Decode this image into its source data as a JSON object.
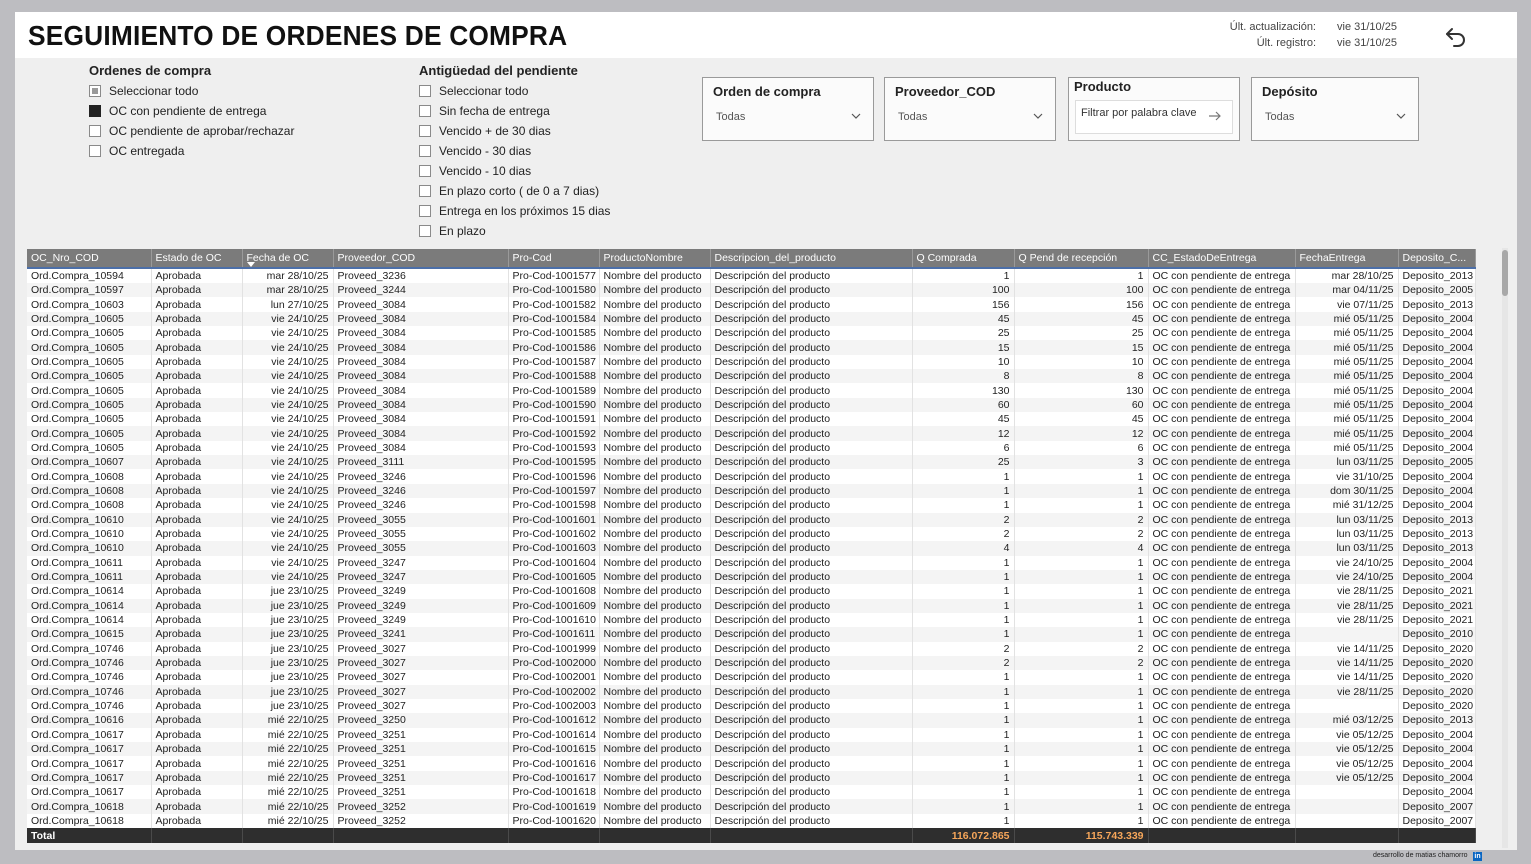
{
  "title": "SEGUIMIENTO DE ORDENES DE COMPRA",
  "update": {
    "last_update_label": "Últ. actualización:",
    "last_update_value": "vie 31/10/25",
    "last_record_label": "Últ. registro:",
    "last_record_value": "vie 31/10/25"
  },
  "back_icon": "undo-arrow-icon",
  "slicer_oc": {
    "title": "Ordenes de compra",
    "items": [
      {
        "label": "Seleccionar todo",
        "state": "partial"
      },
      {
        "label": "OC con pendiente de entrega",
        "state": "checked"
      },
      {
        "label": "OC pendiente de aprobar/rechazar",
        "state": "unchecked"
      },
      {
        "label": "OC entregada",
        "state": "unchecked"
      }
    ]
  },
  "slicer_age": {
    "title": "Antigüedad del pendiente",
    "items": [
      {
        "label": "Seleccionar todo",
        "state": "unchecked"
      },
      {
        "label": "Sin fecha de entrega",
        "state": "unchecked"
      },
      {
        "label": "Vencido + de 30 dias",
        "state": "unchecked"
      },
      {
        "label": "Vencido - 30 dias",
        "state": "unchecked"
      },
      {
        "label": "Vencido - 10 dias",
        "state": "unchecked"
      },
      {
        "label": "En plazo corto ( de 0 a 7 dias)",
        "state": "unchecked"
      },
      {
        "label": "Entrega en los próximos 15 dias",
        "state": "unchecked"
      },
      {
        "label": "En plazo",
        "state": "unchecked"
      }
    ]
  },
  "filters": {
    "orden": {
      "title": "Orden de compra",
      "value": "Todas"
    },
    "proveedor": {
      "title": "Proveedor_COD",
      "value": "Todas"
    },
    "producto": {
      "title": "Producto",
      "placeholder": "Filtrar por palabra clave"
    },
    "deposito": {
      "title": "Depósito",
      "value": "Todas"
    }
  },
  "table": {
    "columns": [
      "OC_Nro_COD",
      "Estado de OC",
      "Fecha de OC",
      "Proveedor_COD",
      "Pro-Cod",
      "ProductoNombre",
      "Descripcion_del_producto",
      "Q Comprada",
      "Q Pend de recepción",
      "CC_EstadoDeEntrega",
      "FechaEntrega",
      "Deposito_C..."
    ],
    "rows": [
      [
        "Ord.Compra_10594",
        "Aprobada",
        "mar 28/10/25",
        "Proveed_3236",
        "Pro-Cod-1001577",
        "Nombre del producto",
        "Descripción del producto",
        "1",
        "1",
        "OC con pendiente de entrega",
        "mar 28/10/25",
        "Deposito_2013"
      ],
      [
        "Ord.Compra_10597",
        "Aprobada",
        "mar 28/10/25",
        "Proveed_3244",
        "Pro-Cod-1001580",
        "Nombre del producto",
        "Descripción del producto",
        "100",
        "100",
        "OC con pendiente de entrega",
        "mar 04/11/25",
        "Deposito_2005"
      ],
      [
        "Ord.Compra_10603",
        "Aprobada",
        "lun 27/10/25",
        "Proveed_3084",
        "Pro-Cod-1001582",
        "Nombre del producto",
        "Descripción del producto",
        "156",
        "156",
        "OC con pendiente de entrega",
        "vie 07/11/25",
        "Deposito_2013"
      ],
      [
        "Ord.Compra_10605",
        "Aprobada",
        "vie 24/10/25",
        "Proveed_3084",
        "Pro-Cod-1001584",
        "Nombre del producto",
        "Descripción del producto",
        "45",
        "45",
        "OC con pendiente de entrega",
        "mié 05/11/25",
        "Deposito_2004"
      ],
      [
        "Ord.Compra_10605",
        "Aprobada",
        "vie 24/10/25",
        "Proveed_3084",
        "Pro-Cod-1001585",
        "Nombre del producto",
        "Descripción del producto",
        "25",
        "25",
        "OC con pendiente de entrega",
        "mié 05/11/25",
        "Deposito_2004"
      ],
      [
        "Ord.Compra_10605",
        "Aprobada",
        "vie 24/10/25",
        "Proveed_3084",
        "Pro-Cod-1001586",
        "Nombre del producto",
        "Descripción del producto",
        "15",
        "15",
        "OC con pendiente de entrega",
        "mié 05/11/25",
        "Deposito_2004"
      ],
      [
        "Ord.Compra_10605",
        "Aprobada",
        "vie 24/10/25",
        "Proveed_3084",
        "Pro-Cod-1001587",
        "Nombre del producto",
        "Descripción del producto",
        "10",
        "10",
        "OC con pendiente de entrega",
        "mié 05/11/25",
        "Deposito_2004"
      ],
      [
        "Ord.Compra_10605",
        "Aprobada",
        "vie 24/10/25",
        "Proveed_3084",
        "Pro-Cod-1001588",
        "Nombre del producto",
        "Descripción del producto",
        "8",
        "8",
        "OC con pendiente de entrega",
        "mié 05/11/25",
        "Deposito_2004"
      ],
      [
        "Ord.Compra_10605",
        "Aprobada",
        "vie 24/10/25",
        "Proveed_3084",
        "Pro-Cod-1001589",
        "Nombre del producto",
        "Descripción del producto",
        "130",
        "130",
        "OC con pendiente de entrega",
        "mié 05/11/25",
        "Deposito_2004"
      ],
      [
        "Ord.Compra_10605",
        "Aprobada",
        "vie 24/10/25",
        "Proveed_3084",
        "Pro-Cod-1001590",
        "Nombre del producto",
        "Descripción del producto",
        "60",
        "60",
        "OC con pendiente de entrega",
        "mié 05/11/25",
        "Deposito_2004"
      ],
      [
        "Ord.Compra_10605",
        "Aprobada",
        "vie 24/10/25",
        "Proveed_3084",
        "Pro-Cod-1001591",
        "Nombre del producto",
        "Descripción del producto",
        "45",
        "45",
        "OC con pendiente de entrega",
        "mié 05/11/25",
        "Deposito_2004"
      ],
      [
        "Ord.Compra_10605",
        "Aprobada",
        "vie 24/10/25",
        "Proveed_3084",
        "Pro-Cod-1001592",
        "Nombre del producto",
        "Descripción del producto",
        "12",
        "12",
        "OC con pendiente de entrega",
        "mié 05/11/25",
        "Deposito_2004"
      ],
      [
        "Ord.Compra_10605",
        "Aprobada",
        "vie 24/10/25",
        "Proveed_3084",
        "Pro-Cod-1001593",
        "Nombre del producto",
        "Descripción del producto",
        "6",
        "6",
        "OC con pendiente de entrega",
        "mié 05/11/25",
        "Deposito_2004"
      ],
      [
        "Ord.Compra_10607",
        "Aprobada",
        "vie 24/10/25",
        "Proveed_3111",
        "Pro-Cod-1001595",
        "Nombre del producto",
        "Descripción del producto",
        "25",
        "3",
        "OC con pendiente de entrega",
        "lun 03/11/25",
        "Deposito_2005"
      ],
      [
        "Ord.Compra_10608",
        "Aprobada",
        "vie 24/10/25",
        "Proveed_3246",
        "Pro-Cod-1001596",
        "Nombre del producto",
        "Descripción del producto",
        "1",
        "1",
        "OC con pendiente de entrega",
        "vie 31/10/25",
        "Deposito_2004"
      ],
      [
        "Ord.Compra_10608",
        "Aprobada",
        "vie 24/10/25",
        "Proveed_3246",
        "Pro-Cod-1001597",
        "Nombre del producto",
        "Descripción del producto",
        "1",
        "1",
        "OC con pendiente de entrega",
        "dom 30/11/25",
        "Deposito_2004"
      ],
      [
        "Ord.Compra_10608",
        "Aprobada",
        "vie 24/10/25",
        "Proveed_3246",
        "Pro-Cod-1001598",
        "Nombre del producto",
        "Descripción del producto",
        "1",
        "1",
        "OC con pendiente de entrega",
        "mié 31/12/25",
        "Deposito_2004"
      ],
      [
        "Ord.Compra_10610",
        "Aprobada",
        "vie 24/10/25",
        "Proveed_3055",
        "Pro-Cod-1001601",
        "Nombre del producto",
        "Descripción del producto",
        "2",
        "2",
        "OC con pendiente de entrega",
        "lun 03/11/25",
        "Deposito_2013"
      ],
      [
        "Ord.Compra_10610",
        "Aprobada",
        "vie 24/10/25",
        "Proveed_3055",
        "Pro-Cod-1001602",
        "Nombre del producto",
        "Descripción del producto",
        "2",
        "2",
        "OC con pendiente de entrega",
        "lun 03/11/25",
        "Deposito_2013"
      ],
      [
        "Ord.Compra_10610",
        "Aprobada",
        "vie 24/10/25",
        "Proveed_3055",
        "Pro-Cod-1001603",
        "Nombre del producto",
        "Descripción del producto",
        "4",
        "4",
        "OC con pendiente de entrega",
        "lun 03/11/25",
        "Deposito_2013"
      ],
      [
        "Ord.Compra_10611",
        "Aprobada",
        "vie 24/10/25",
        "Proveed_3247",
        "Pro-Cod-1001604",
        "Nombre del producto",
        "Descripción del producto",
        "1",
        "1",
        "OC con pendiente de entrega",
        "vie 24/10/25",
        "Deposito_2004"
      ],
      [
        "Ord.Compra_10611",
        "Aprobada",
        "vie 24/10/25",
        "Proveed_3247",
        "Pro-Cod-1001605",
        "Nombre del producto",
        "Descripción del producto",
        "1",
        "1",
        "OC con pendiente de entrega",
        "vie 24/10/25",
        "Deposito_2004"
      ],
      [
        "Ord.Compra_10614",
        "Aprobada",
        "jue 23/10/25",
        "Proveed_3249",
        "Pro-Cod-1001608",
        "Nombre del producto",
        "Descripción del producto",
        "1",
        "1",
        "OC con pendiente de entrega",
        "vie 28/11/25",
        "Deposito_2021"
      ],
      [
        "Ord.Compra_10614",
        "Aprobada",
        "jue 23/10/25",
        "Proveed_3249",
        "Pro-Cod-1001609",
        "Nombre del producto",
        "Descripción del producto",
        "1",
        "1",
        "OC con pendiente de entrega",
        "vie 28/11/25",
        "Deposito_2021"
      ],
      [
        "Ord.Compra_10614",
        "Aprobada",
        "jue 23/10/25",
        "Proveed_3249",
        "Pro-Cod-1001610",
        "Nombre del producto",
        "Descripción del producto",
        "1",
        "1",
        "OC con pendiente de entrega",
        "vie 28/11/25",
        "Deposito_2021"
      ],
      [
        "Ord.Compra_10615",
        "Aprobada",
        "jue 23/10/25",
        "Proveed_3241",
        "Pro-Cod-1001611",
        "Nombre del producto",
        "Descripción del producto",
        "1",
        "1",
        "OC con pendiente de entrega",
        "",
        "Deposito_2010"
      ],
      [
        "Ord.Compra_10746",
        "Aprobada",
        "jue 23/10/25",
        "Proveed_3027",
        "Pro-Cod-1001999",
        "Nombre del producto",
        "Descripción del producto",
        "2",
        "2",
        "OC con pendiente de entrega",
        "vie 14/11/25",
        "Deposito_2020"
      ],
      [
        "Ord.Compra_10746",
        "Aprobada",
        "jue 23/10/25",
        "Proveed_3027",
        "Pro-Cod-1002000",
        "Nombre del producto",
        "Descripción del producto",
        "2",
        "2",
        "OC con pendiente de entrega",
        "vie 14/11/25",
        "Deposito_2020"
      ],
      [
        "Ord.Compra_10746",
        "Aprobada",
        "jue 23/10/25",
        "Proveed_3027",
        "Pro-Cod-1002001",
        "Nombre del producto",
        "Descripción del producto",
        "1",
        "1",
        "OC con pendiente de entrega",
        "vie 14/11/25",
        "Deposito_2020"
      ],
      [
        "Ord.Compra_10746",
        "Aprobada",
        "jue 23/10/25",
        "Proveed_3027",
        "Pro-Cod-1002002",
        "Nombre del producto",
        "Descripción del producto",
        "1",
        "1",
        "OC con pendiente de entrega",
        "vie 28/11/25",
        "Deposito_2020"
      ],
      [
        "Ord.Compra_10746",
        "Aprobada",
        "jue 23/10/25",
        "Proveed_3027",
        "Pro-Cod-1002003",
        "Nombre del producto",
        "Descripción del producto",
        "1",
        "1",
        "OC con pendiente de entrega",
        "",
        "Deposito_2020"
      ],
      [
        "Ord.Compra_10616",
        "Aprobada",
        "mié 22/10/25",
        "Proveed_3250",
        "Pro-Cod-1001612",
        "Nombre del producto",
        "Descripción del producto",
        "1",
        "1",
        "OC con pendiente de entrega",
        "mié 03/12/25",
        "Deposito_2013"
      ],
      [
        "Ord.Compra_10617",
        "Aprobada",
        "mié 22/10/25",
        "Proveed_3251",
        "Pro-Cod-1001614",
        "Nombre del producto",
        "Descripción del producto",
        "1",
        "1",
        "OC con pendiente de entrega",
        "vie 05/12/25",
        "Deposito_2004"
      ],
      [
        "Ord.Compra_10617",
        "Aprobada",
        "mié 22/10/25",
        "Proveed_3251",
        "Pro-Cod-1001615",
        "Nombre del producto",
        "Descripción del producto",
        "1",
        "1",
        "OC con pendiente de entrega",
        "vie 05/12/25",
        "Deposito_2004"
      ],
      [
        "Ord.Compra_10617",
        "Aprobada",
        "mié 22/10/25",
        "Proveed_3251",
        "Pro-Cod-1001616",
        "Nombre del producto",
        "Descripción del producto",
        "1",
        "1",
        "OC con pendiente de entrega",
        "vie 05/12/25",
        "Deposito_2004"
      ],
      [
        "Ord.Compra_10617",
        "Aprobada",
        "mié 22/10/25",
        "Proveed_3251",
        "Pro-Cod-1001617",
        "Nombre del producto",
        "Descripción del producto",
        "1",
        "1",
        "OC con pendiente de entrega",
        "vie 05/12/25",
        "Deposito_2004"
      ],
      [
        "Ord.Compra_10617",
        "Aprobada",
        "mié 22/10/25",
        "Proveed_3251",
        "Pro-Cod-1001618",
        "Nombre del producto",
        "Descripción del producto",
        "1",
        "1",
        "OC con pendiente de entrega",
        "",
        "Deposito_2004"
      ],
      [
        "Ord.Compra_10618",
        "Aprobada",
        "mié 22/10/25",
        "Proveed_3252",
        "Pro-Cod-1001619",
        "Nombre del producto",
        "Descripción del producto",
        "1",
        "1",
        "OC con pendiente de entrega",
        "",
        "Deposito_2007"
      ],
      [
        "Ord.Compra_10618",
        "Aprobada",
        "mié 22/10/25",
        "Proveed_3252",
        "Pro-Cod-1001620",
        "Nombre del producto",
        "Descripción del producto",
        "1",
        "1",
        "OC con pendiente de entrega",
        "",
        "Deposito_2007"
      ]
    ],
    "total_label": "Total",
    "total_q_comprada": "116.072.865",
    "total_q_pend": "115.743.339"
  },
  "credit": "desarrollo de matias chamorro",
  "credit_icon": "linkedin-icon",
  "colors": {
    "header_bg": "#7b7b7b",
    "total_bg": "#2e2e2e",
    "total_value": "#f6a65a",
    "sort_line": "#4c6fa8"
  }
}
